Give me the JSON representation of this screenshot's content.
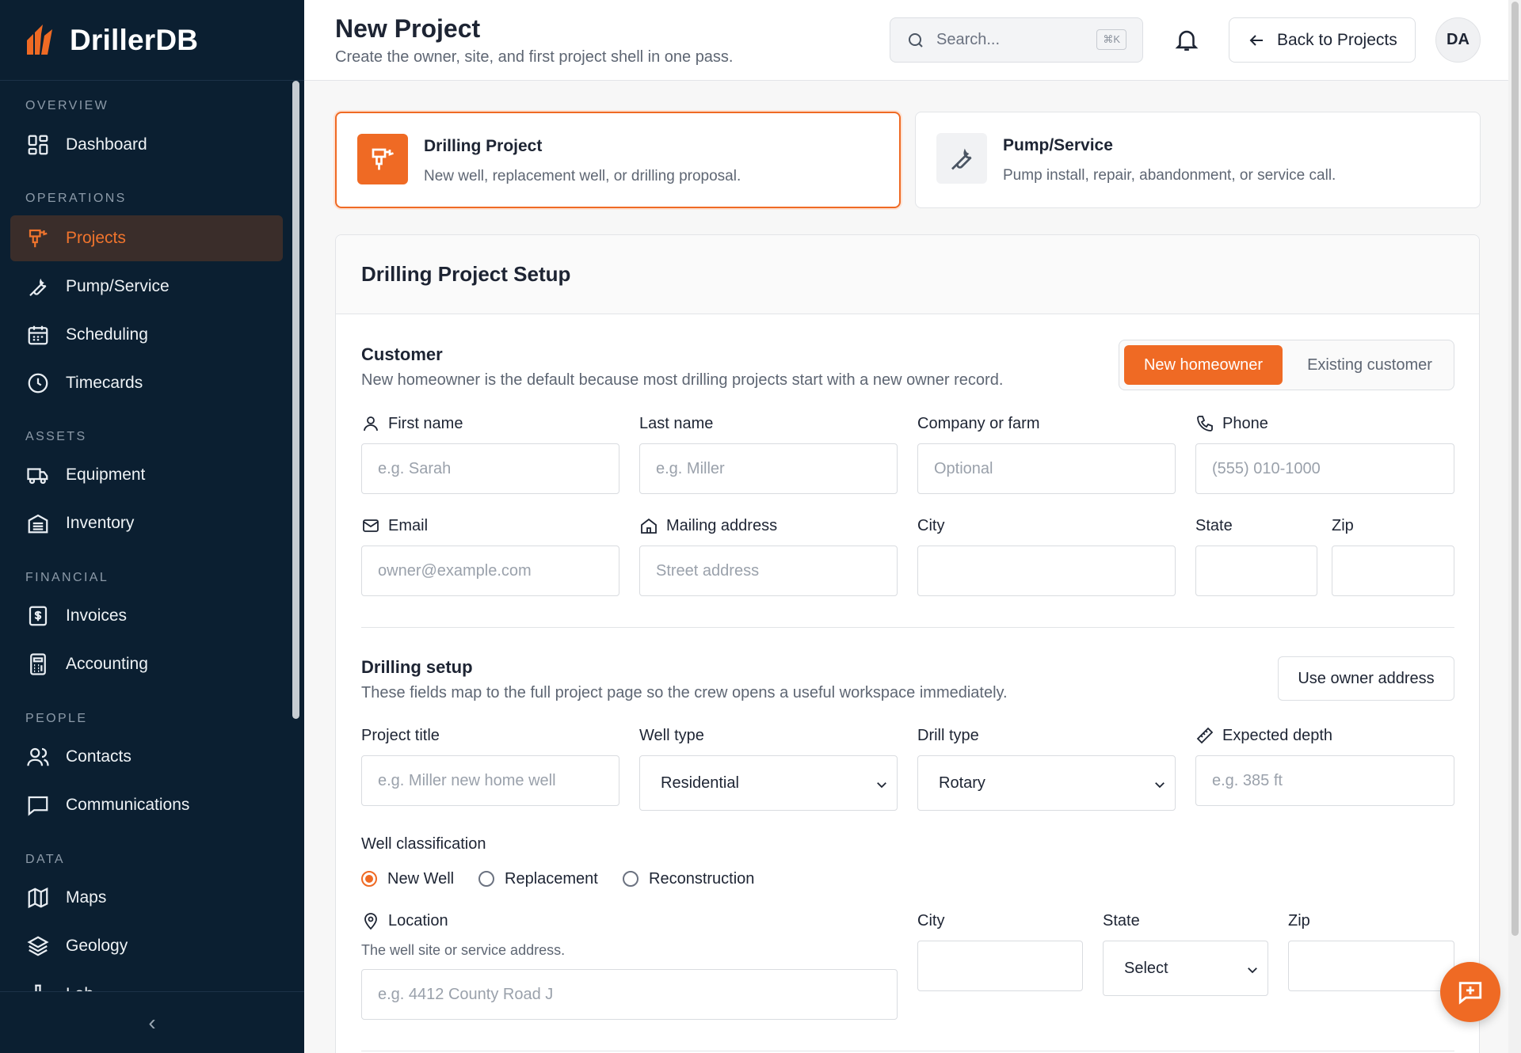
{
  "brand": {
    "name": "DrillerDB"
  },
  "sidebar": {
    "sections": [
      {
        "label": "OVERVIEW"
      },
      {
        "label": "OPERATIONS"
      },
      {
        "label": "ASSETS"
      },
      {
        "label": "FINANCIAL"
      },
      {
        "label": "PEOPLE"
      },
      {
        "label": "DATA"
      }
    ],
    "items": [
      {
        "label": "Dashboard",
        "icon": "dashboard-icon"
      },
      {
        "label": "Projects",
        "icon": "drill-icon",
        "active": true
      },
      {
        "label": "Pump/Service",
        "icon": "wrench-icon"
      },
      {
        "label": "Scheduling",
        "icon": "calendar-icon"
      },
      {
        "label": "Timecards",
        "icon": "clock-icon"
      },
      {
        "label": "Equipment",
        "icon": "truck-icon"
      },
      {
        "label": "Inventory",
        "icon": "warehouse-icon"
      },
      {
        "label": "Invoices",
        "icon": "invoice-icon"
      },
      {
        "label": "Accounting",
        "icon": "calculator-icon"
      },
      {
        "label": "Contacts",
        "icon": "users-icon"
      },
      {
        "label": "Communications",
        "icon": "message-icon"
      },
      {
        "label": "Maps",
        "icon": "map-icon"
      },
      {
        "label": "Geology",
        "icon": "layers-icon"
      },
      {
        "label": "Lab",
        "icon": "flask-icon"
      }
    ],
    "collapse_glyph": "‹",
    "active_color": "#f0742d"
  },
  "header": {
    "title": "New Project",
    "subtitle": "Create the owner, site, and first project shell in one pass.",
    "search_placeholder": "Search...",
    "search_shortcut": "⌘K",
    "back_label": "Back to Projects",
    "avatar_initials": "DA"
  },
  "project_types": [
    {
      "title": "Drilling Project",
      "description": "New well, replacement well, or drilling proposal.",
      "selected": true
    },
    {
      "title": "Pump/Service",
      "description": "Pump install, repair, abandonment, or service call.",
      "selected": false
    }
  ],
  "setup": {
    "title": "Drilling Project Setup",
    "customer": {
      "title": "Customer",
      "description": "New homeowner is the default because most drilling projects start with a new owner record.",
      "toggle": {
        "selected": "New homeowner",
        "other": "Existing customer"
      },
      "fields": {
        "first_name": {
          "label": "First name",
          "placeholder": "e.g. Sarah"
        },
        "last_name": {
          "label": "Last name",
          "placeholder": "e.g. Miller"
        },
        "company": {
          "label": "Company or farm",
          "placeholder": "Optional"
        },
        "phone": {
          "label": "Phone",
          "placeholder": "(555) 010-1000"
        },
        "email": {
          "label": "Email",
          "placeholder": "owner@example.com"
        },
        "mailing": {
          "label": "Mailing address",
          "placeholder": "Street address"
        },
        "city": {
          "label": "City",
          "placeholder": ""
        },
        "state": {
          "label": "State",
          "placeholder": ""
        },
        "zip": {
          "label": "Zip",
          "placeholder": ""
        }
      }
    },
    "drilling": {
      "title": "Drilling setup",
      "description": "These fields map to the full project page so the crew opens a useful workspace immediately.",
      "use_owner_address_label": "Use owner address",
      "project_title": {
        "label": "Project title",
        "placeholder": "e.g. Miller new home well"
      },
      "well_type": {
        "label": "Well type",
        "value": "Residential"
      },
      "drill_type": {
        "label": "Drill type",
        "value": "Rotary"
      },
      "expected_depth": {
        "label": "Expected depth",
        "placeholder": "e.g. 385 ft"
      },
      "classification": {
        "label": "Well classification",
        "options": [
          "New Well",
          "Replacement",
          "Reconstruction"
        ],
        "selected": "New Well"
      },
      "location": {
        "label": "Location",
        "help": "The well site or service address.",
        "placeholder": "e.g. 4412 County Road J"
      },
      "site_city": {
        "label": "City",
        "placeholder": ""
      },
      "site_state": {
        "label": "State",
        "value": "Select"
      },
      "site_zip": {
        "label": "Zip",
        "placeholder": ""
      }
    }
  },
  "colors": {
    "accent": "#ef6a24",
    "sidebar_bg": "#0b1f31"
  }
}
